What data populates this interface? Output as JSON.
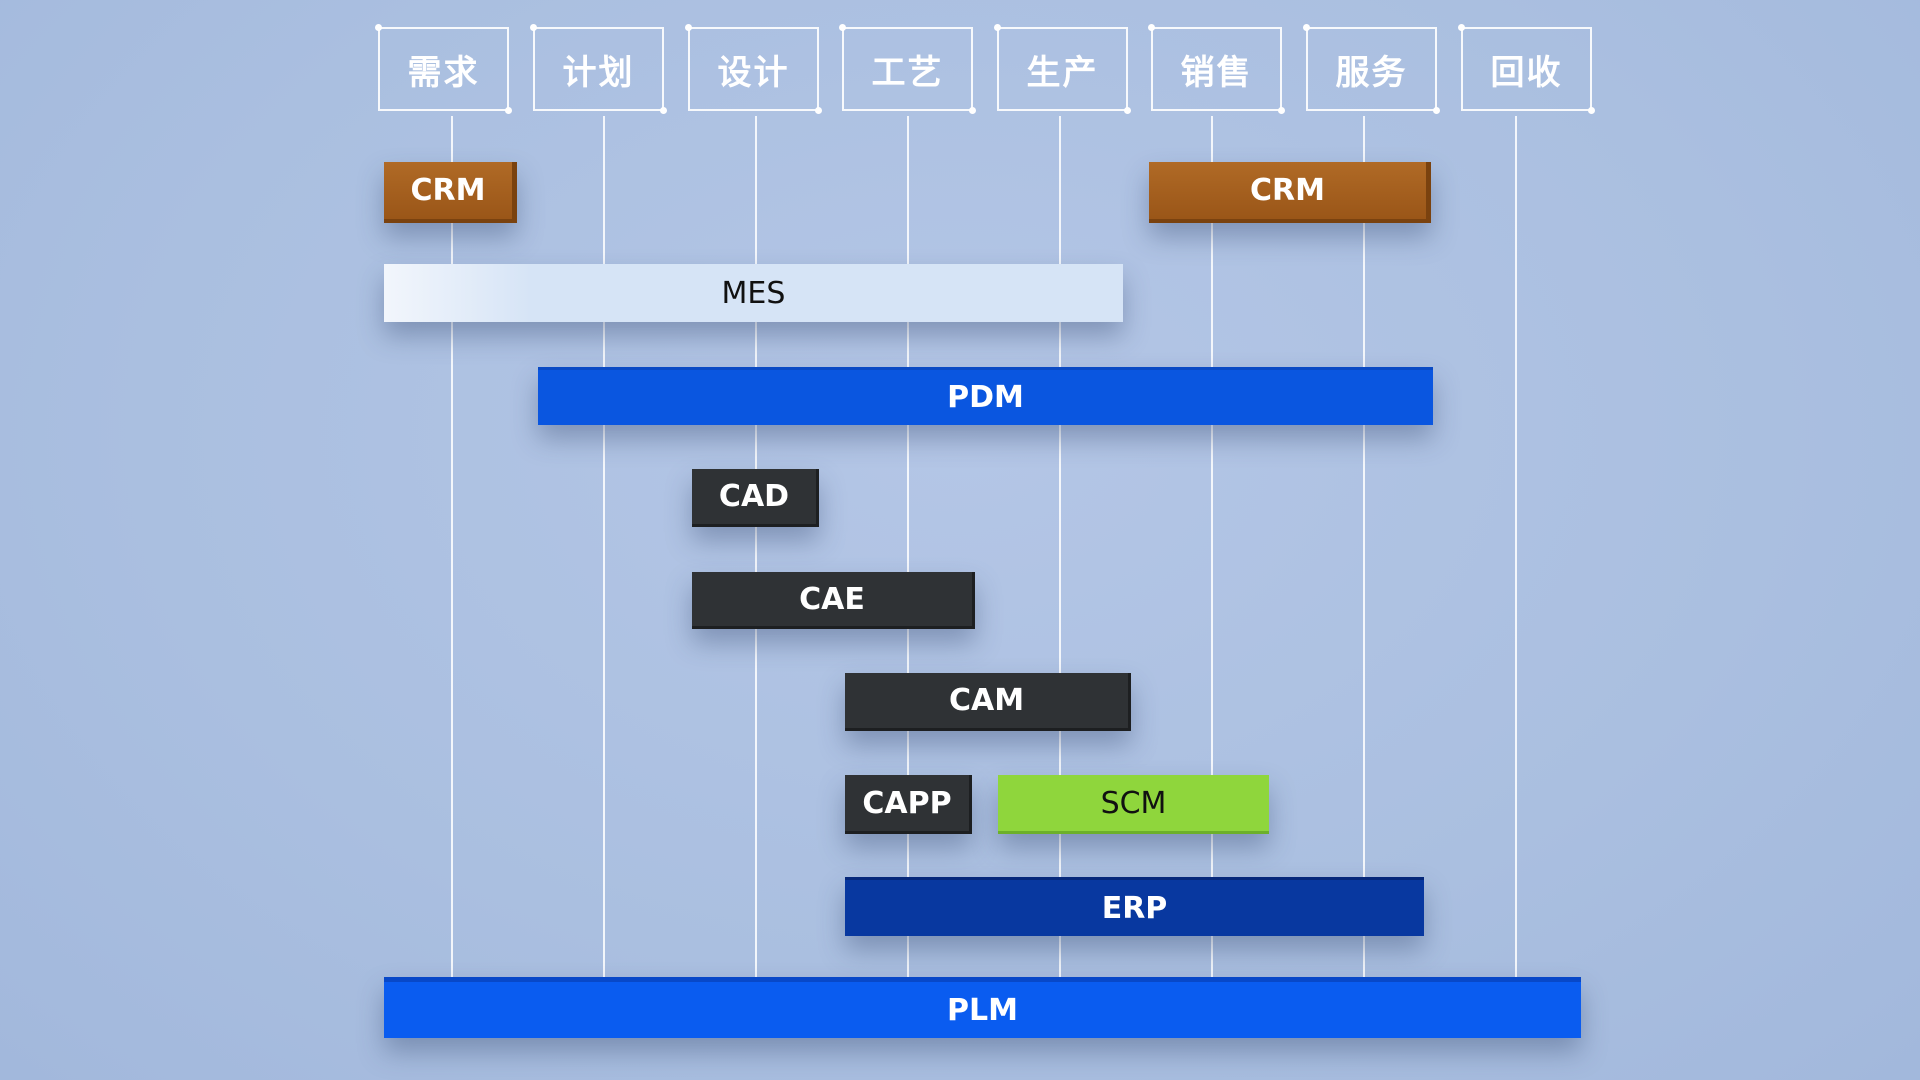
{
  "stages": [
    "需求",
    "计划",
    "设计",
    "工艺",
    "生产",
    "销售",
    "服务",
    "回收"
  ],
  "systems": {
    "crm_left": "CRM",
    "crm_right": "CRM",
    "mes": "MES",
    "pdm": "PDM",
    "cad": "CAD",
    "cae": "CAE",
    "cam": "CAM",
    "capp": "CAPP",
    "scm": "SCM",
    "erp": "ERP",
    "plm": "PLM"
  },
  "colors": {
    "crm": "#a35f1f",
    "mes": "#d6e4f6",
    "pdm": "#0a56e0",
    "cad_cae_cam_capp": "#2f3235",
    "scm": "#8fd63c",
    "erp": "#0838a0",
    "plm": "#0a5cf0",
    "background": "#aec2e2"
  }
}
